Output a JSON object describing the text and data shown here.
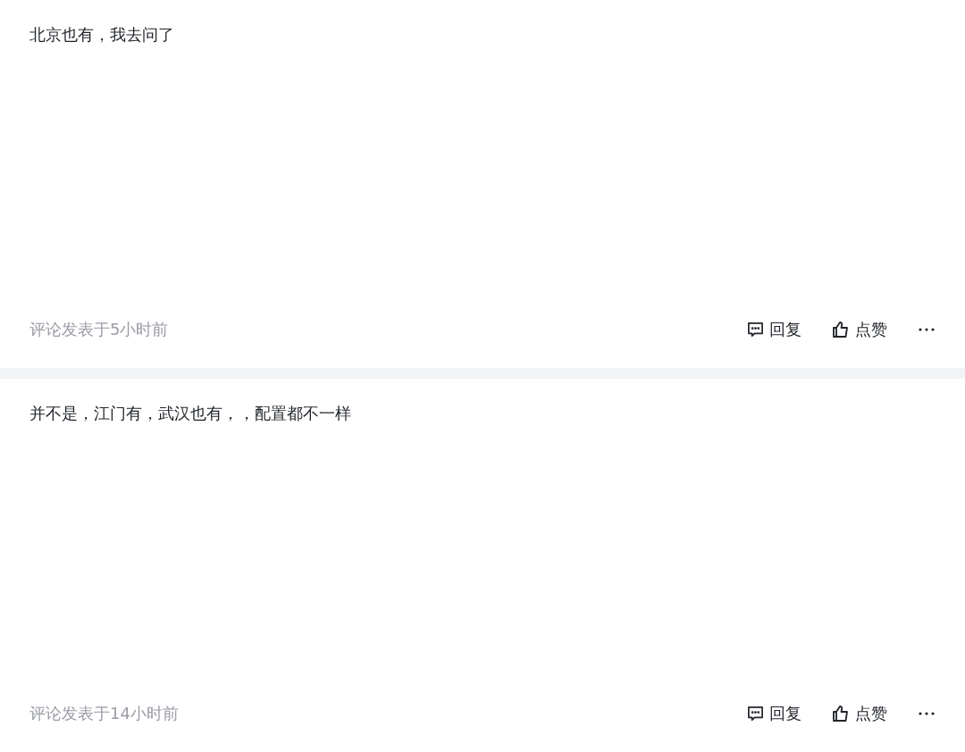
{
  "comments": [
    {
      "text": "北京也有，我去问了",
      "time": "评论发表于5小时前",
      "reply": "回复",
      "like": "点赞"
    },
    {
      "text": "并不是，江门有，武汉也有，，配置都不一样",
      "time": "评论发表于14小时前",
      "reply": "回复",
      "like": "点赞"
    }
  ]
}
